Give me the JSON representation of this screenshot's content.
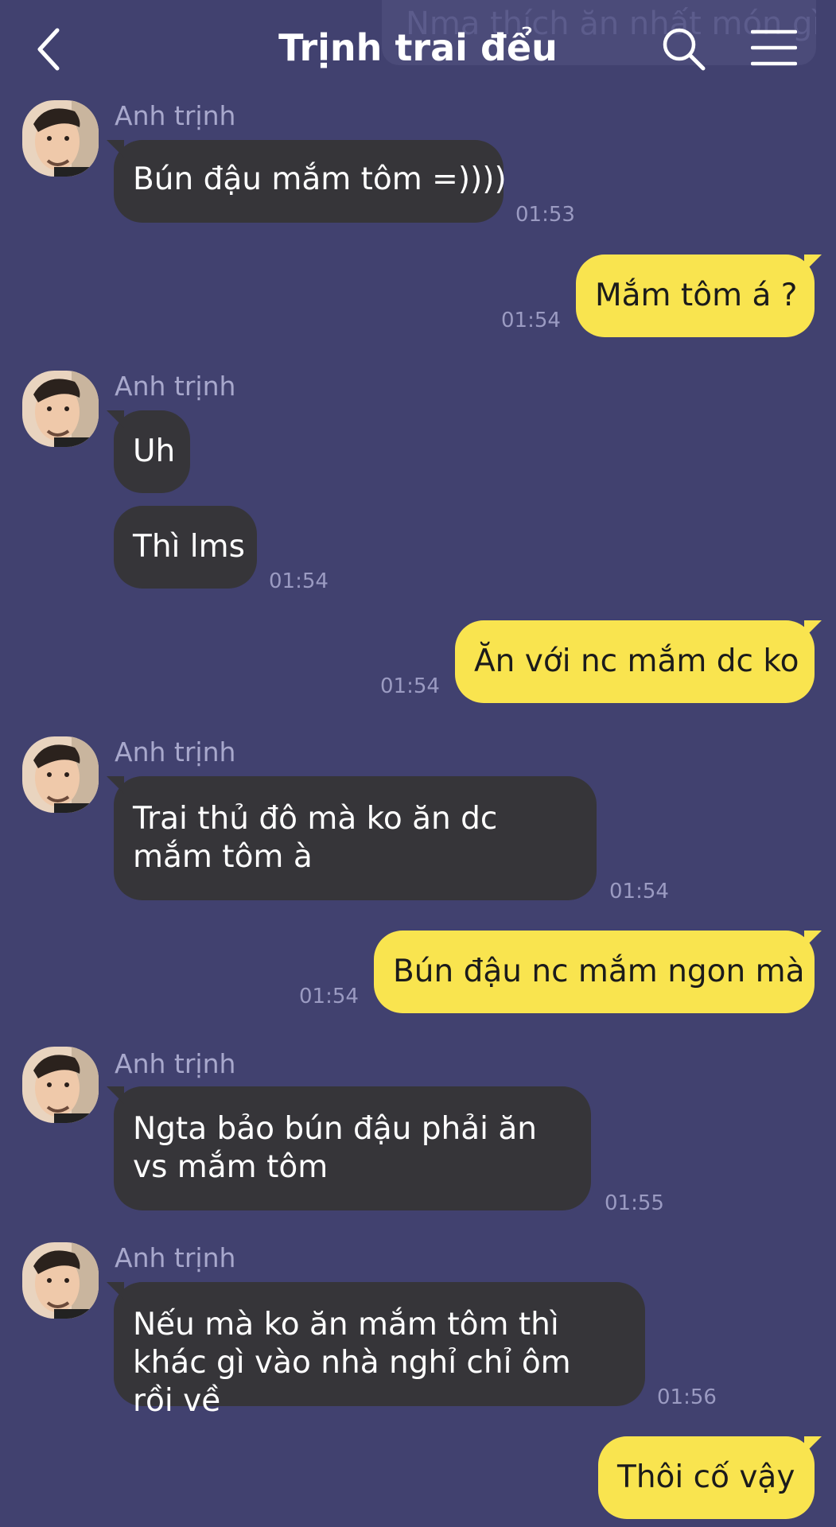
{
  "header": {
    "title": "Trịnh trai đểu",
    "ghost_text": "Nma thích ăn nhất món gì",
    "icons": [
      "back-icon",
      "search-icon",
      "menu-icon"
    ]
  },
  "contact_name": "Anh trịnh",
  "messages": [
    {
      "side": "in",
      "text": "Bún đậu mắm tôm =))))",
      "time": "01:53"
    },
    {
      "side": "out",
      "text": "Mắm tôm á ?",
      "time": "01:54"
    },
    {
      "side": "in",
      "text": "Uh",
      "time": ""
    },
    {
      "side": "in",
      "text": "Thì lms",
      "time": "01:54"
    },
    {
      "side": "out",
      "text": "Ăn với nc mắm dc ko",
      "time": "01:54"
    },
    {
      "side": "in",
      "text": "Trai thủ đô mà ko ăn dc mắm tôm à",
      "time": "01:54"
    },
    {
      "side": "out",
      "text": "Bún đậu nc mắm ngon mà",
      "time": "01:54"
    },
    {
      "side": "in",
      "text": "Ngta bảo bún đậu phải ăn vs mắm tôm",
      "time": "01:55"
    },
    {
      "side": "in",
      "text": "Nếu mà ko ăn mắm tôm thì khác gì vào nhà nghỉ chỉ ôm rồi về",
      "time": "01:56"
    },
    {
      "side": "out",
      "text": "Thôi cố vậy",
      "time": ""
    }
  ],
  "colors": {
    "background": "#41416f",
    "incoming_bubble": "#363539",
    "outgoing_bubble": "#f9e44f",
    "timestamp": "#9b9bc2"
  }
}
